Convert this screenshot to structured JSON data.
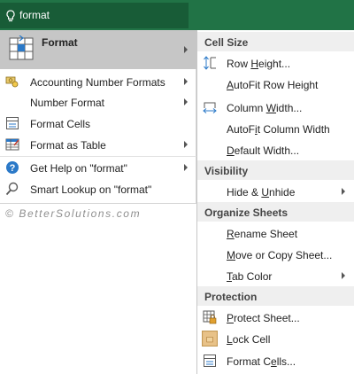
{
  "search": {
    "query": "format"
  },
  "left_menu": {
    "format_label": "Format",
    "items": [
      {
        "label": "Accounting Number Formats"
      },
      {
        "label": "Number Format"
      },
      {
        "label": "Format Cells"
      },
      {
        "label": "Format as Table"
      },
      {
        "label": "Get Help on \"format\""
      },
      {
        "label": "Smart Lookup on \"format\""
      }
    ]
  },
  "watermark": "© BetterSolutions.com",
  "submenu": {
    "sections": [
      {
        "title": "Cell Size"
      },
      {
        "title": "Visibility"
      },
      {
        "title": "Organize Sheets"
      },
      {
        "title": "Protection"
      }
    ],
    "row_height": {
      "pre": "Row ",
      "u": "H",
      "post": "eight..."
    },
    "autofit_row": {
      "pre": "",
      "u": "A",
      "post": "utoFit Row Height"
    },
    "column_width": {
      "pre": "Column ",
      "u": "W",
      "post": "idth..."
    },
    "autofit_col": {
      "pre": "AutoF",
      "u": "i",
      "post": "t Column Width"
    },
    "default_width": {
      "pre": "",
      "u": "D",
      "post": "efault Width..."
    },
    "hide_unhide": {
      "pre": "Hide & ",
      "u": "U",
      "post": "nhide"
    },
    "rename_sheet": {
      "pre": "",
      "u": "R",
      "post": "ename Sheet"
    },
    "move_copy": {
      "pre": "",
      "u": "M",
      "post": "ove or Copy Sheet..."
    },
    "tab_color": {
      "pre": "",
      "u": "T",
      "post": "ab Color"
    },
    "protect_sheet": {
      "pre": "",
      "u": "P",
      "post": "rotect Sheet..."
    },
    "lock_cell": {
      "pre": "",
      "u": "L",
      "post": "ock Cell"
    },
    "format_cells": {
      "pre": "Format C",
      "u": "e",
      "post": "lls..."
    }
  },
  "colors": {
    "ribbon": "#217346",
    "search": "#185c37",
    "hover": "#c6c6c6",
    "section": "#efefef"
  }
}
